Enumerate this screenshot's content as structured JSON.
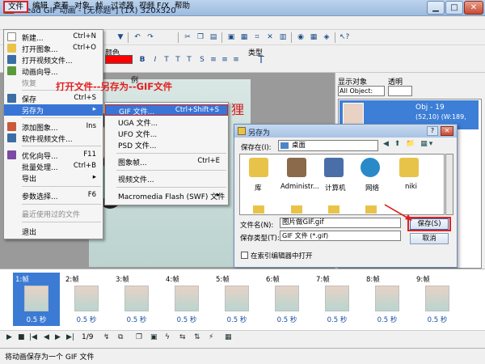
{
  "window": {
    "title": "Ulead GIF 动画 - [无标题*] (1X) 320x320",
    "min_glyph": "▁",
    "max_glyph": "□",
    "close_glyph": "✕"
  },
  "menubar": [
    {
      "label": "文件"
    },
    {
      "label": "编辑"
    },
    {
      "label": "查看"
    },
    {
      "label": "对象"
    },
    {
      "label": "帧"
    },
    {
      "label": "过滤器"
    },
    {
      "label": "视频 F/X"
    },
    {
      "label": "帮助"
    }
  ],
  "toolbar2": {
    "color_label": "颜色",
    "type_label": "类型",
    "typed_partial": "例"
  },
  "file_menu": [
    {
      "label": "新建...",
      "shortcut": "Ctrl+N"
    },
    {
      "label": "打开图象...",
      "shortcut": "Ctrl+O"
    },
    {
      "label": "打开视频文件...",
      "shortcut": ""
    },
    {
      "label": "动画向导...",
      "shortcut": ""
    },
    {
      "label": "恢复",
      "shortcut": "",
      "disabled": true
    },
    {
      "label": "保存",
      "shortcut": "Ctrl+S"
    },
    {
      "label": "另存为",
      "shortcut": "▸",
      "highlight": true
    },
    {
      "label": "添加图象...",
      "shortcut": "Ins"
    },
    {
      "label": "软件视频文件...",
      "shortcut": ""
    },
    {
      "label": "优化向导...",
      "shortcut": "F11"
    },
    {
      "label": "批量处理...",
      "shortcut": "Ctrl+B"
    },
    {
      "label": "导出",
      "shortcut": "▸"
    },
    {
      "label": "参数选择...",
      "shortcut": "F6"
    },
    {
      "label": "最近使用过的文件",
      "shortcut": "",
      "disabled": true
    },
    {
      "label": "退出",
      "shortcut": ""
    }
  ],
  "saveas_menu": [
    {
      "label": "GIF 文件...",
      "shortcut": "Ctrl+Shift+S",
      "highlight": true
    },
    {
      "label": "UGA 文件...",
      "shortcut": ""
    },
    {
      "label": "UFO 文件...",
      "shortcut": ""
    },
    {
      "label": "PSD 文件...",
      "shortcut": ""
    },
    {
      "label": "图象帧...",
      "shortcut": "Ctrl+E"
    },
    {
      "label": "视频文件...",
      "shortcut": ""
    },
    {
      "label": "Macromedia Flash (SWF) 文件",
      "shortcut": "▸"
    }
  ],
  "annotation": "打开文件--另存为--GIF文件",
  "canvas_text": "狸",
  "right_panel": {
    "objects_label": "显示对象",
    "objects_value": "All Object:",
    "opacity_label": "透明",
    "item_line1": "Obj - 19",
    "item_line2": "(52,10) (W:189,"
  },
  "dialog": {
    "title": "另存为",
    "help_glyph": "?",
    "close_glyph": "✕",
    "save_in_label": "保存在(I):",
    "save_in_value": "桌面",
    "nav_glyphs": "◀ ⬆ 📁 ▦▾",
    "files": [
      {
        "label": "库",
        "color": "#e8c34a"
      },
      {
        "label": "Administr...",
        "color": "#8a6a4a"
      },
      {
        "label": "计算机",
        "color": "#4a6ea8"
      },
      {
        "label": "网络",
        "color": "#2a8ac8"
      },
      {
        "label": "niki",
        "color": "#e8c34a"
      }
    ],
    "filename_label": "文件名(N):",
    "filename_value": "图片做GIF.gif",
    "filetype_label": "保存类型(T):",
    "filetype_value": "GIF 文件 (*.gif)",
    "save_button": "保存(S)",
    "cancel_button": "取消",
    "checkbox_label": "在索引编辑器中打开"
  },
  "frames": [
    {
      "label": "1:帧",
      "time": "0.5 秒",
      "selected": true
    },
    {
      "label": "2:帧",
      "time": "0.5 秒"
    },
    {
      "label": "3:帧",
      "time": "0.5 秒"
    },
    {
      "label": "4:帧",
      "time": "0.5 秒"
    },
    {
      "label": "5:帧",
      "time": "0.5 秒"
    },
    {
      "label": "6:帧",
      "time": "0.5 秒"
    },
    {
      "label": "7:帧",
      "time": "0.5 秒"
    },
    {
      "label": "8:帧",
      "time": "0.5 秒"
    },
    {
      "label": "9:帧",
      "time": "0.5 秒"
    }
  ],
  "controls": {
    "frame_counter": "1/9"
  },
  "status": "将动画保存为一个 GIF 文件",
  "colors": {
    "accent": "#3875d7",
    "annotation_red": "#e01f1f"
  }
}
